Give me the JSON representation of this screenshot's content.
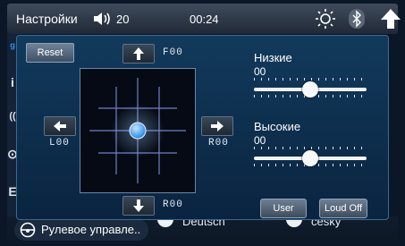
{
  "topbar": {
    "title": "Настройки",
    "volume": "20",
    "time": "00:24"
  },
  "balance": {
    "reset_label": "Reset",
    "front_label": "F00",
    "rear_label": "R00",
    "left_label": "L00",
    "right_label": "R00"
  },
  "eq": {
    "bass_label": "Низкие",
    "bass_value": "00",
    "bass_level": 0.5,
    "treble_label": "Высокие",
    "treble_value": "00",
    "treble_level": 0.5
  },
  "buttons": {
    "user_label": "User",
    "loud_label": "Loud Off"
  },
  "bottom": {
    "steering_label": "Рулевое управле..",
    "lang1": "Deutsch",
    "lang2": "česky"
  },
  "colors": {
    "panel": "#123a5c",
    "accent": "#2f8ee8"
  }
}
